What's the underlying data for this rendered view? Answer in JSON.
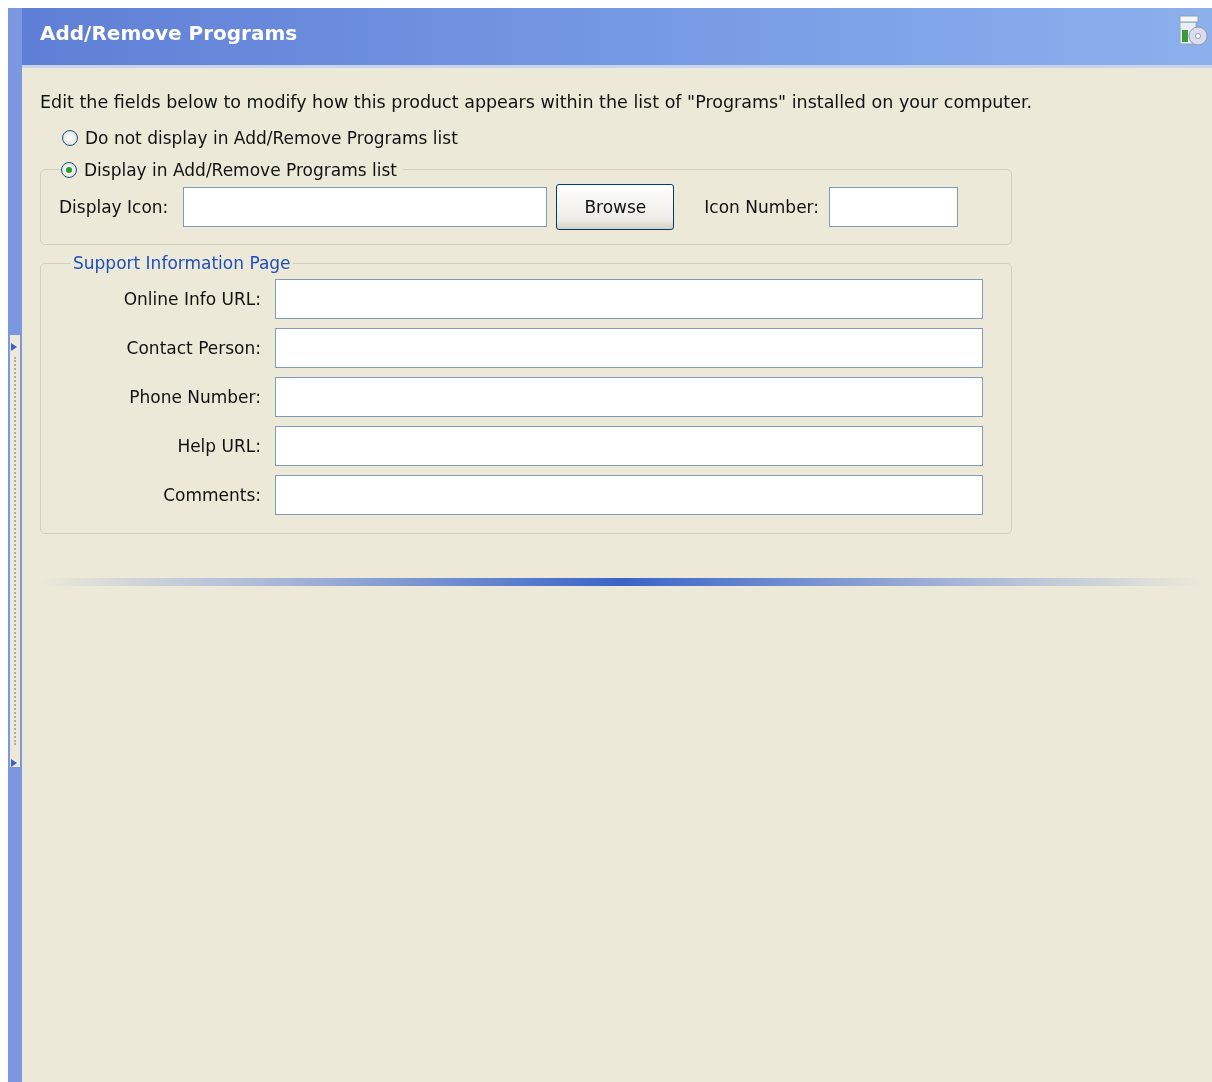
{
  "header": {
    "title": "Add/Remove Programs"
  },
  "intro": "Edit the fields below to modify how this product appears within the list of \"Programs\" installed on your computer.",
  "display_options": [
    {
      "label": "Do not display in Add/Remove Programs list",
      "selected": false
    },
    {
      "label": "Display in Add/Remove Programs list",
      "selected": true
    }
  ],
  "display_icon": {
    "label": "Display Icon:",
    "button": "Browse",
    "icon_number_label": "Icon Number:"
  },
  "support_group": {
    "title": "Support Information Page",
    "fields": [
      {
        "label": "Online Info URL:"
      },
      {
        "label": "Contact Person:"
      },
      {
        "label": "Phone Number:"
      },
      {
        "label": "Help URL:"
      },
      {
        "label": "Comments:"
      }
    ]
  }
}
